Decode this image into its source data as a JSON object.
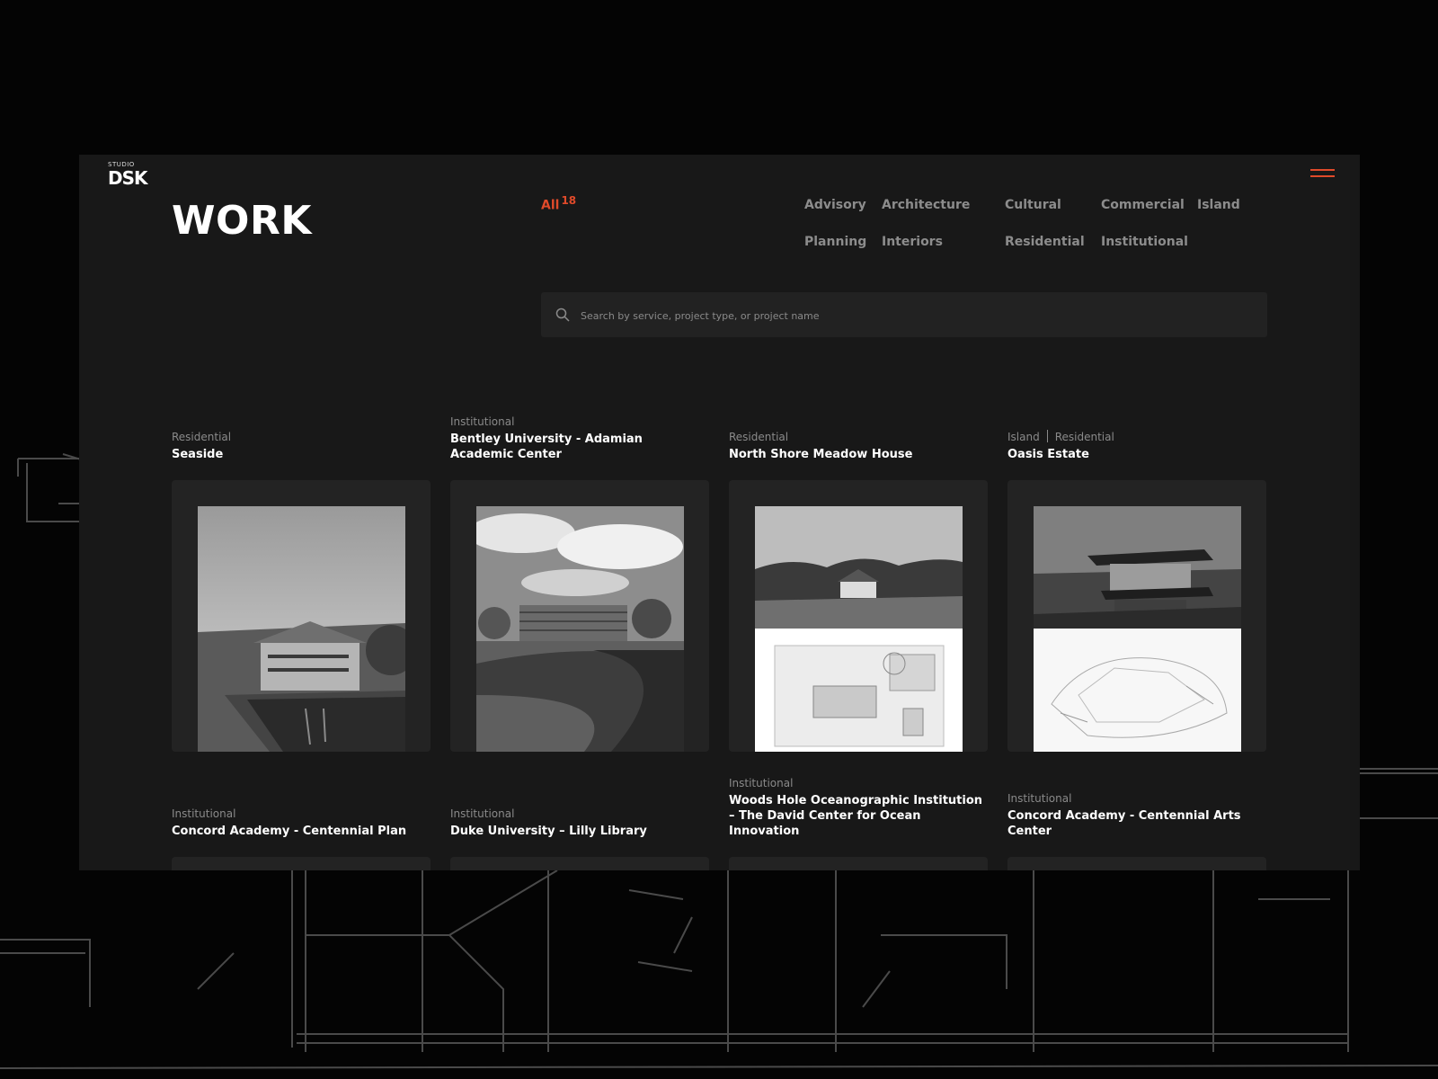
{
  "brand": {
    "logo_small": "STUDIO",
    "logo_big": "DSK"
  },
  "header": {
    "title": "WORK"
  },
  "filters": {
    "all": {
      "label": "All",
      "count": "18"
    },
    "items": [
      "Advisory",
      "Architecture",
      "Cultural",
      "Commercial",
      "Island",
      "Planning",
      "Interiors",
      "Residential",
      "Institutional"
    ]
  },
  "search": {
    "placeholder": "Search by service, project type, or project name",
    "value": ""
  },
  "projects": [
    {
      "categories": [
        "Residential"
      ],
      "name": "Seaside"
    },
    {
      "categories": [
        "Institutional"
      ],
      "name": "Bentley University - Adamian Academic Center"
    },
    {
      "categories": [
        "Residential"
      ],
      "name": "North Shore Meadow House"
    },
    {
      "categories": [
        "Island",
        "Residential"
      ],
      "name": "Oasis Estate"
    },
    {
      "categories": [
        "Institutional"
      ],
      "name": "Concord Academy - Centennial Plan"
    },
    {
      "categories": [
        "Institutional"
      ],
      "name": "Duke University – Lilly Library"
    },
    {
      "categories": [
        "Institutional"
      ],
      "name": "Woods Hole Oceanographic Institution – The David Center for Ocean Innovation"
    },
    {
      "categories": [
        "Institutional"
      ],
      "name": "Concord Academy - Centennial Arts Center"
    }
  ],
  "colors": {
    "accent": "#e04a2a",
    "background": "#040404",
    "panel": "#181818",
    "card": "#232323"
  }
}
